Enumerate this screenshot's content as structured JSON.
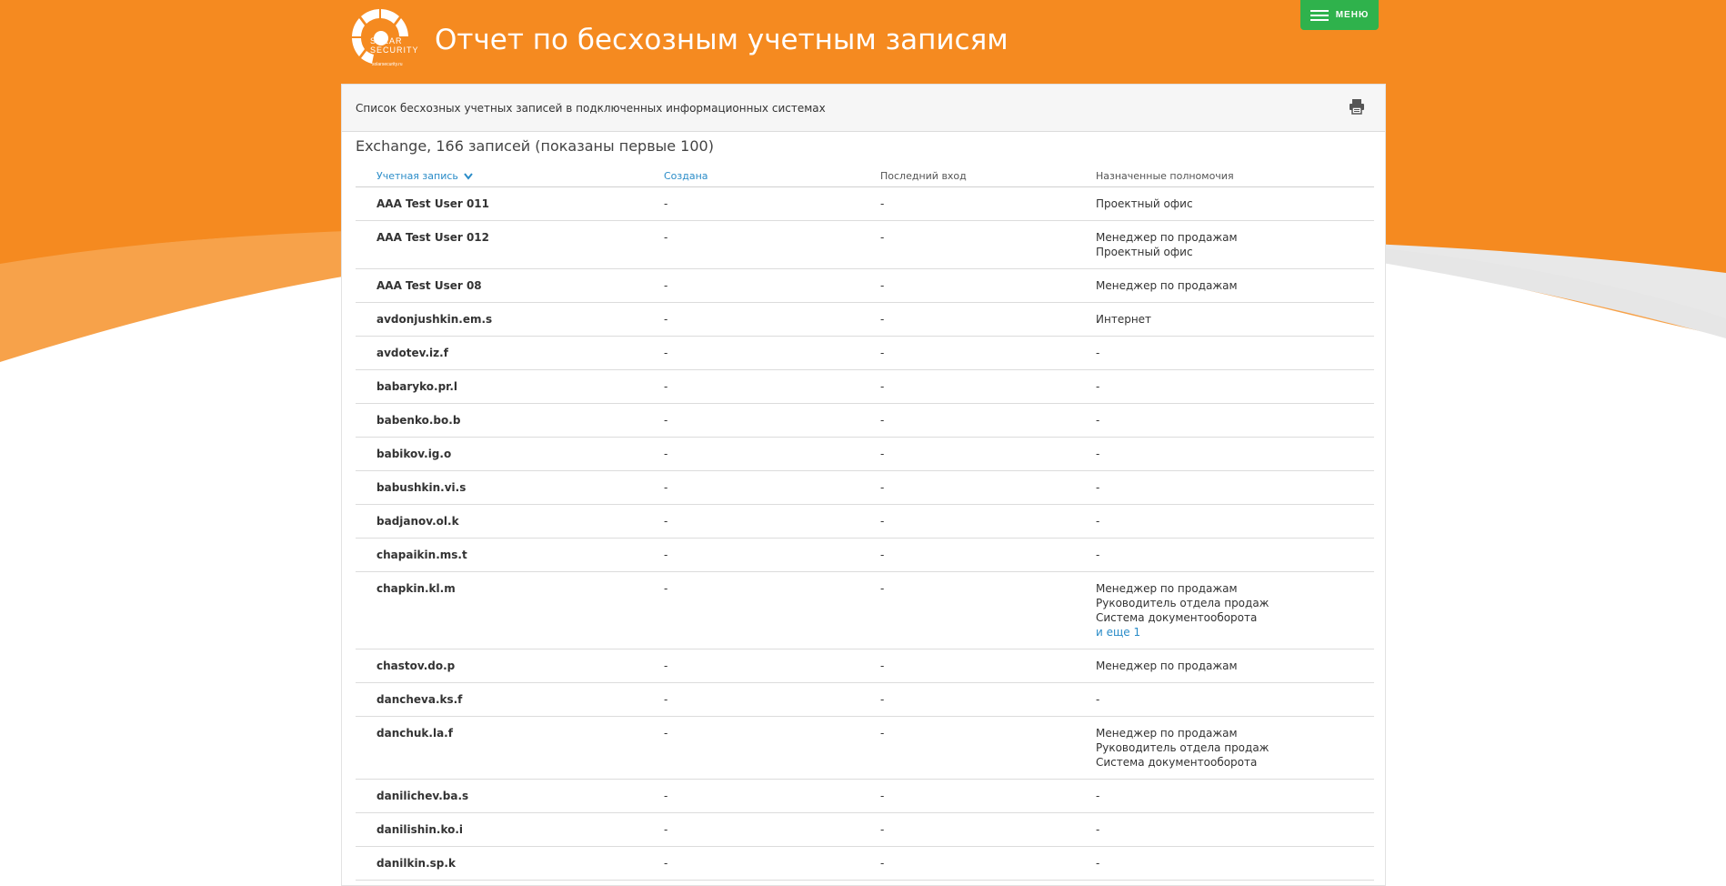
{
  "header": {
    "title": "Отчет по бесхозным учетным записям",
    "logo_text_line1": "SOLAR",
    "logo_text_line2": "SECURITY",
    "logo_sub": "solarsecurity.ru",
    "menu_label": "МЕНЮ"
  },
  "panel": {
    "description": "Список бесхозных учетных записей в подключенных информационных системах",
    "section_title": "Exchange, 166 записей (показаны первые 100)"
  },
  "table": {
    "columns": [
      "Учетная запись",
      "Создана",
      "Последний вход",
      "Назначенные полномочия"
    ],
    "rows": [
      {
        "account": "AAA Test User 011",
        "created": "-",
        "last_login": "-",
        "perm1": "Проектный офис",
        "perm2": "",
        "perm3": "",
        "more": ""
      },
      {
        "account": "AAA Test User 012",
        "created": "-",
        "last_login": "-",
        "perm1": "Менеджер по продажам",
        "perm2": "Проектный офис",
        "perm3": "",
        "more": ""
      },
      {
        "account": "AAA Test User 08",
        "created": "-",
        "last_login": "-",
        "perm1": "Менеджер по продажам",
        "perm2": "",
        "perm3": "",
        "more": ""
      },
      {
        "account": "avdonjushkin.em.s",
        "created": "-",
        "last_login": "-",
        "perm1": "Интернет",
        "perm2": "",
        "perm3": "",
        "more": ""
      },
      {
        "account": "avdotev.iz.f",
        "created": "-",
        "last_login": "-",
        "perm1": "-",
        "perm2": "",
        "perm3": "",
        "more": ""
      },
      {
        "account": "babaryko.pr.l",
        "created": "-",
        "last_login": "-",
        "perm1": "-",
        "perm2": "",
        "perm3": "",
        "more": ""
      },
      {
        "account": "babenko.bo.b",
        "created": "-",
        "last_login": "-",
        "perm1": "-",
        "perm2": "",
        "perm3": "",
        "more": ""
      },
      {
        "account": "babikov.ig.o",
        "created": "-",
        "last_login": "-",
        "perm1": "-",
        "perm2": "",
        "perm3": "",
        "more": ""
      },
      {
        "account": "babushkin.vi.s",
        "created": "-",
        "last_login": "-",
        "perm1": "-",
        "perm2": "",
        "perm3": "",
        "more": ""
      },
      {
        "account": "badjanov.ol.k",
        "created": "-",
        "last_login": "-",
        "perm1": "-",
        "perm2": "",
        "perm3": "",
        "more": ""
      },
      {
        "account": "chapaikin.ms.t",
        "created": "-",
        "last_login": "-",
        "perm1": "-",
        "perm2": "",
        "perm3": "",
        "more": ""
      },
      {
        "account": "chapkin.kl.m",
        "created": "-",
        "last_login": "-",
        "perm1": "Менеджер по продажам",
        "perm2": "Руководитель отдела продаж",
        "perm3": "Система документооборота",
        "more": "и еще 1"
      },
      {
        "account": "chastov.do.p",
        "created": "-",
        "last_login": "-",
        "perm1": "Менеджер по продажам",
        "perm2": "",
        "perm3": "",
        "more": ""
      },
      {
        "account": "dancheva.ks.f",
        "created": "-",
        "last_login": "-",
        "perm1": "-",
        "perm2": "",
        "perm3": "",
        "more": ""
      },
      {
        "account": "danchuk.la.f",
        "created": "-",
        "last_login": "-",
        "perm1": "Менеджер по продажам",
        "perm2": "Руководитель отдела продаж",
        "perm3": "Система документооборота",
        "more": ""
      },
      {
        "account": "danilichev.ba.s",
        "created": "-",
        "last_login": "-",
        "perm1": "-",
        "perm2": "",
        "perm3": "",
        "more": ""
      },
      {
        "account": "danilishin.ko.i",
        "created": "-",
        "last_login": "-",
        "perm1": "-",
        "perm2": "",
        "perm3": "",
        "more": ""
      },
      {
        "account": "danilkin.sp.k",
        "created": "-",
        "last_login": "-",
        "perm1": "-",
        "perm2": "",
        "perm3": "",
        "more": ""
      }
    ]
  },
  "colors": {
    "orange": "#f58a20",
    "orange_light": "#f7a24a",
    "green": "#2fb24c",
    "link": "#2a8cc8"
  },
  "icons": {
    "menu": "hamburger-icon",
    "print": "printer-icon",
    "sort": "chevron-down-icon"
  }
}
